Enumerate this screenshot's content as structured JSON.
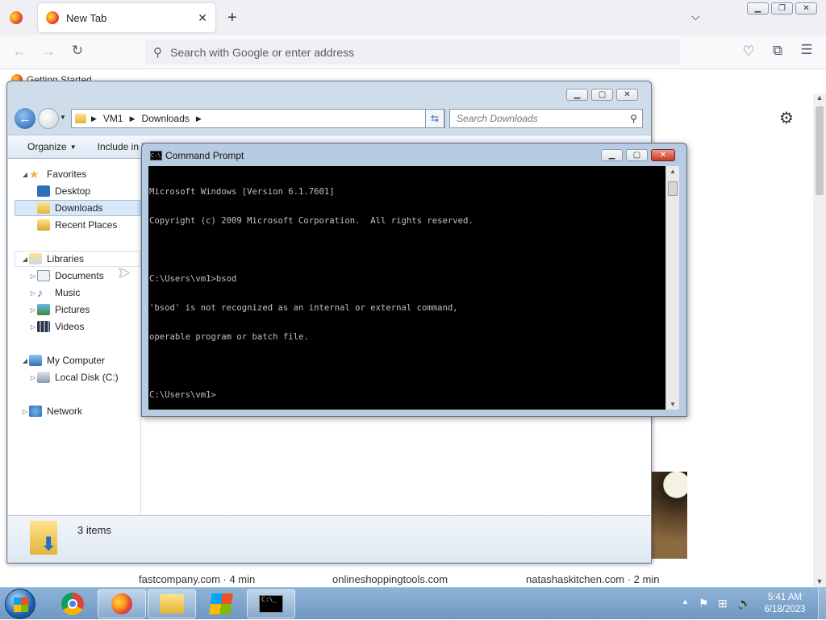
{
  "firefox": {
    "tab_title": "New Tab",
    "new_tab_label": "+",
    "address_placeholder": "Search with Google or enter address",
    "bookmark_label": "Getting Started",
    "cards": [
      "fastcompany.com · 4 min",
      "onlineshoppingtools.com",
      "natashaskitchen.com · 2 min"
    ]
  },
  "explorer": {
    "breadcrumb": [
      "VM1",
      "Downloads"
    ],
    "search_placeholder": "Search Downloads",
    "toolbar": {
      "organize": "Organize",
      "include": "Include in library"
    },
    "favorites": {
      "label": "Favorites",
      "items": [
        "Desktop",
        "Downloads",
        "Recent Places"
      ]
    },
    "libraries": {
      "label": "Libraries",
      "items": [
        "Documents",
        "Music",
        "Pictures",
        "Videos"
      ]
    },
    "computer": {
      "label": "My Computer",
      "items": [
        "Local Disk (C:)"
      ]
    },
    "network": "Network",
    "status": "3 items",
    "selected_item": "Downloads"
  },
  "cmd": {
    "title": "Command Prompt",
    "lines": [
      "Microsoft Windows [Version 6.1.7601]",
      "Copyright (c) 2009 Microsoft Corporation.  All rights reserved.",
      "",
      "C:\\Users\\vm1>bsod",
      "'bsod' is not recognized as an internal or external command,",
      "operable program or batch file.",
      "",
      "C:\\Users\\vm1>"
    ]
  },
  "taskbar": {
    "clock_time": "5:41 AM",
    "clock_date": "6/18/2023",
    "apps": [
      "start-button",
      "chrome",
      "firefox",
      "explorer",
      "media-player",
      "cmd"
    ]
  },
  "colors": {
    "cmd_bg": "#000000",
    "cmd_fg": "#c0c0c0",
    "selection": "#cce4f7",
    "taskbar": "#7aa3cc"
  }
}
